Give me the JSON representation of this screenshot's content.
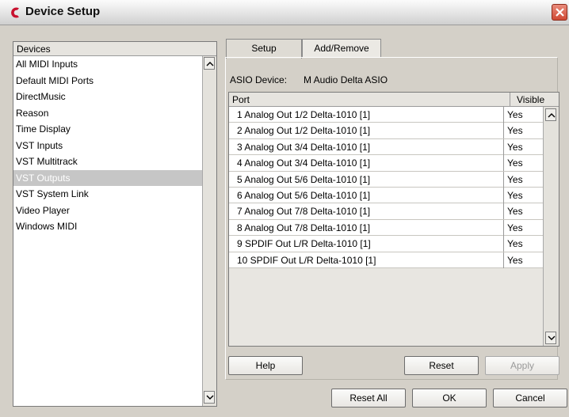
{
  "window": {
    "title": "Device Setup"
  },
  "devices": {
    "header": "Devices",
    "items": [
      "All MIDI Inputs",
      "Default MIDI Ports",
      "DirectMusic",
      "Reason",
      "Time Display",
      "VST Inputs",
      "VST Multitrack",
      "VST Outputs",
      "VST System Link",
      "Video Player",
      "Windows MIDI"
    ],
    "selected_index": 7
  },
  "tabs": [
    {
      "label": "Setup",
      "active": true
    },
    {
      "label": "Add/Remove",
      "active": false
    }
  ],
  "asio": {
    "label": "ASIO Device:",
    "value": "M Audio Delta ASIO"
  },
  "port_table": {
    "headers": {
      "port": "Port",
      "visible": "Visible"
    },
    "rows": [
      {
        "port": "1 Analog Out 1/2 Delta-1010 [1]",
        "visible": "Yes"
      },
      {
        "port": "2 Analog Out 1/2 Delta-1010 [1]",
        "visible": "Yes"
      },
      {
        "port": "3 Analog Out 3/4 Delta-1010 [1]",
        "visible": "Yes"
      },
      {
        "port": "4 Analog Out 3/4 Delta-1010 [1]",
        "visible": "Yes"
      },
      {
        "port": "5 Analog Out 5/6 Delta-1010 [1]",
        "visible": "Yes"
      },
      {
        "port": "6 Analog Out 5/6 Delta-1010 [1]",
        "visible": "Yes"
      },
      {
        "port": "7 Analog Out 7/8 Delta-1010 [1]",
        "visible": "Yes"
      },
      {
        "port": "8 Analog Out 7/8 Delta-1010 [1]",
        "visible": "Yes"
      },
      {
        "port": "9 SPDIF Out L/R Delta-1010 [1]",
        "visible": "Yes"
      },
      {
        "port": "10 SPDIF Out L/R Delta-1010 [1]",
        "visible": "Yes"
      }
    ]
  },
  "buttons": {
    "help": "Help",
    "reset": "Reset",
    "apply": "Apply",
    "reset_all": "Reset All",
    "ok": "OK",
    "cancel": "Cancel"
  },
  "colors": {
    "accent": "#c8102e",
    "selection": "#c6c6c6",
    "close": "#d04a34"
  },
  "icons": {
    "app": "cubase-logo-icon",
    "close": "close-icon",
    "scroll_up": "arrow-up-icon",
    "scroll_down": "arrow-down-icon"
  }
}
